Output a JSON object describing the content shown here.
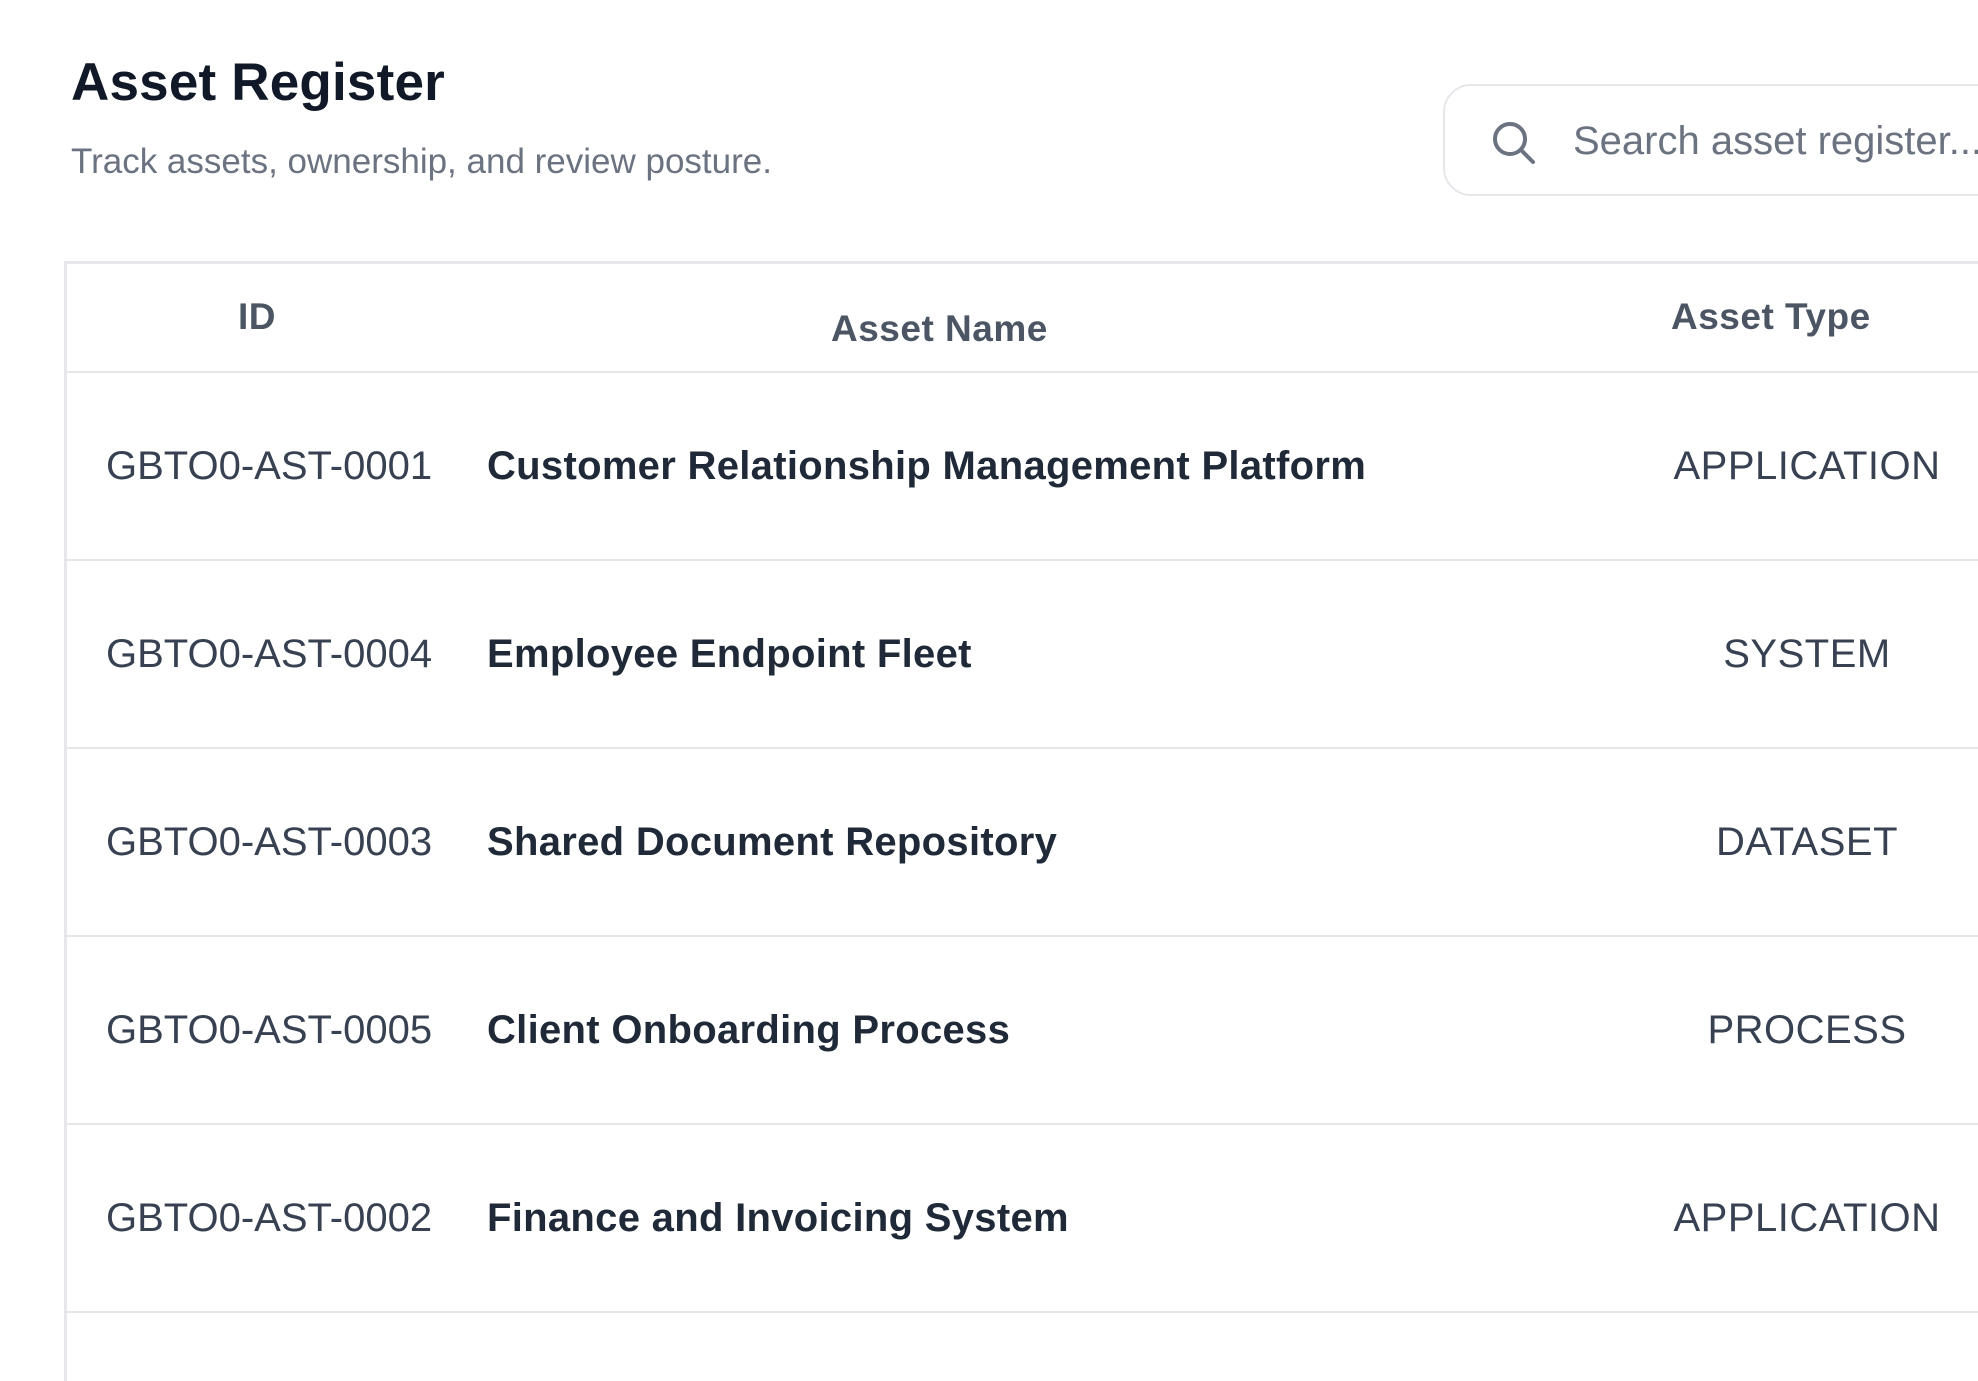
{
  "header": {
    "title": "Asset Register",
    "subtitle": "Track assets, ownership, and review posture."
  },
  "search": {
    "icon": "search-icon",
    "placeholder": "Search asset register..."
  },
  "table": {
    "columns": {
      "id": "ID",
      "name": "Asset Name",
      "type": "Asset Type"
    },
    "rows": [
      {
        "id": "GBTO0-AST-0001",
        "name": "Customer Relationship Management Platform",
        "type": "APPLICATION"
      },
      {
        "id": "GBTO0-AST-0004",
        "name": "Employee Endpoint Fleet",
        "type": "SYSTEM"
      },
      {
        "id": "GBTO0-AST-0003",
        "name": "Shared Document Repository",
        "type": "DATASET"
      },
      {
        "id": "GBTO0-AST-0005",
        "name": "Client Onboarding Process",
        "type": "PROCESS"
      },
      {
        "id": "GBTO0-AST-0002",
        "name": "Finance and Invoicing System",
        "type": "APPLICATION"
      }
    ]
  }
}
